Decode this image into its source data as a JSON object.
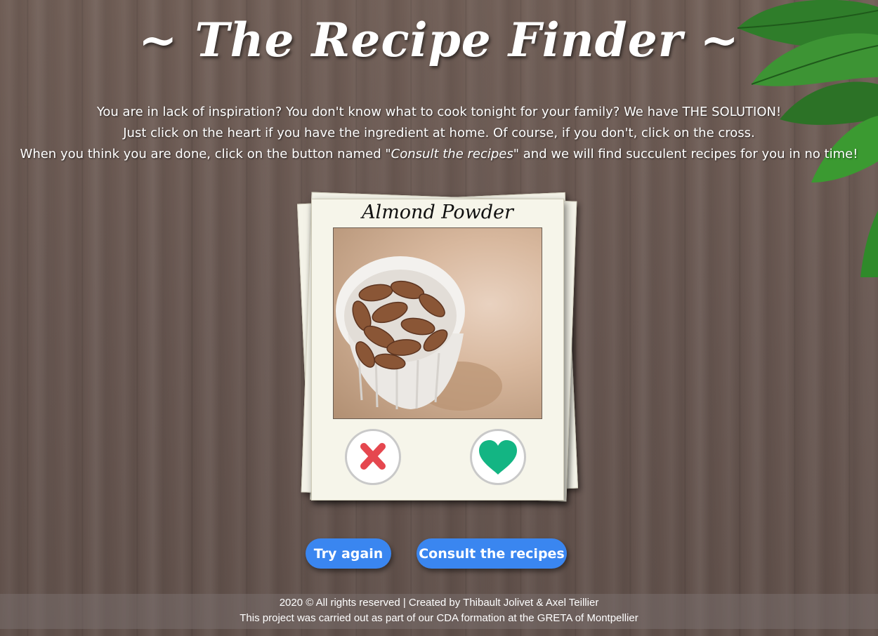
{
  "header": {
    "title": "~ The Recipe Finder ~"
  },
  "intro": {
    "line1": "You are in lack of inspiration? You don't know what to cook tonight for your family? We have THE SOLUTION!",
    "line2": "Just click on the heart if you have the ingredient at home. Of course, if you don't, click on the cross.",
    "line3_before": "When you think you are done, click on the button named ",
    "line3_emph": "\"Consult the recipes\"",
    "line3_after": " and we will find succulent recipes for you in no time!"
  },
  "card": {
    "ingredient_name": "Almond Powder",
    "photo_icon": "almonds-in-bowl-photo",
    "reject_icon": "cross-icon",
    "accept_icon": "heart-icon"
  },
  "actions": {
    "try_again_label": "Try again",
    "consult_label": "Consult the recipes"
  },
  "footer": {
    "line1": "2020 © All rights reserved | Created by Thibault Jolivet & Axel Teillier",
    "line2": "This project was carried out as part of our CDA formation at the GRETA of Montpellier"
  },
  "colors": {
    "accent_button": "#3a86f0",
    "reject_color": "#e5474f",
    "accept_color": "#13b583",
    "card_background": "#f6f5ea"
  }
}
